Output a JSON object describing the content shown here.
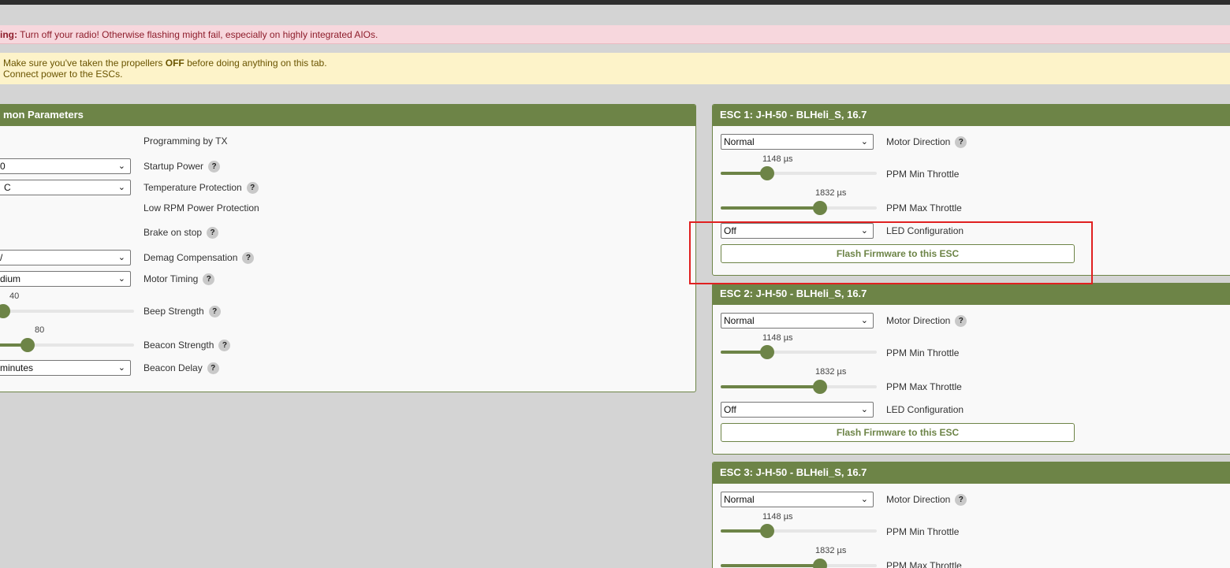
{
  "warnings": {
    "radio_bold": "ing:",
    "radio_text": " Turn off your radio! Otherwise flashing might fail, especially on highly integrated AIOs.",
    "props_pre": "Make sure you've taken the propellers ",
    "props_bold": "OFF",
    "props_post": " before doing anything on this tab.",
    "power": "Connect power to the ESCs."
  },
  "common": {
    "title": "mon Parameters",
    "rows": [
      {
        "label": "Programming by TX"
      },
      {
        "label": "Startup Power",
        "value": "0"
      },
      {
        "label": "Temperature Protection",
        "value": "C"
      },
      {
        "label": "Low RPM Power Protection"
      },
      {
        "label": "Brake on stop"
      },
      {
        "label": "Demag Compensation",
        "value": "/"
      },
      {
        "label": "Motor Timing",
        "value": "dium"
      },
      {
        "label": "Beep Strength",
        "value": "40",
        "level": 40
      },
      {
        "label": "Beacon Strength",
        "value": "80",
        "level": 80
      },
      {
        "label": "Beacon Delay",
        "value": "minutes"
      }
    ]
  },
  "escs": [
    {
      "title": "ESC 1: J-H-50 - BLHeli_S, 16.7",
      "direction": "Normal",
      "direction_label": "Motor Direction",
      "min_val": "1148 µs",
      "min_label": "PPM Min Throttle",
      "min_level": 1148,
      "max_val": "1832 µs",
      "max_label": "PPM Max Throttle",
      "max_level": 1832,
      "led": "Off",
      "led_label": "LED Configuration",
      "flash": "Flash Firmware to this ESC"
    },
    {
      "title": "ESC 2: J-H-50 - BLHeli_S, 16.7",
      "direction": "Normal",
      "direction_label": "Motor Direction",
      "min_val": "1148 µs",
      "min_label": "PPM Min Throttle",
      "min_level": 1148,
      "max_val": "1832 µs",
      "max_label": "PPM Max Throttle",
      "max_level": 1832,
      "led": "Off",
      "led_label": "LED Configuration",
      "flash": "Flash Firmware to this ESC"
    },
    {
      "title": "ESC 3: J-H-50 - BLHeli_S, 16.7",
      "direction": "Normal",
      "direction_label": "Motor Direction",
      "min_val": "1148 µs",
      "min_label": "PPM Min Throttle",
      "min_level": 1148,
      "max_val": "1832 µs",
      "max_label": "PPM Max Throttle",
      "max_level": 1832
    }
  ],
  "help_glyph": "?",
  "chevron_glyph": "⌄",
  "colors": {
    "accent": "#6d8447",
    "highlight": "#e02020"
  }
}
